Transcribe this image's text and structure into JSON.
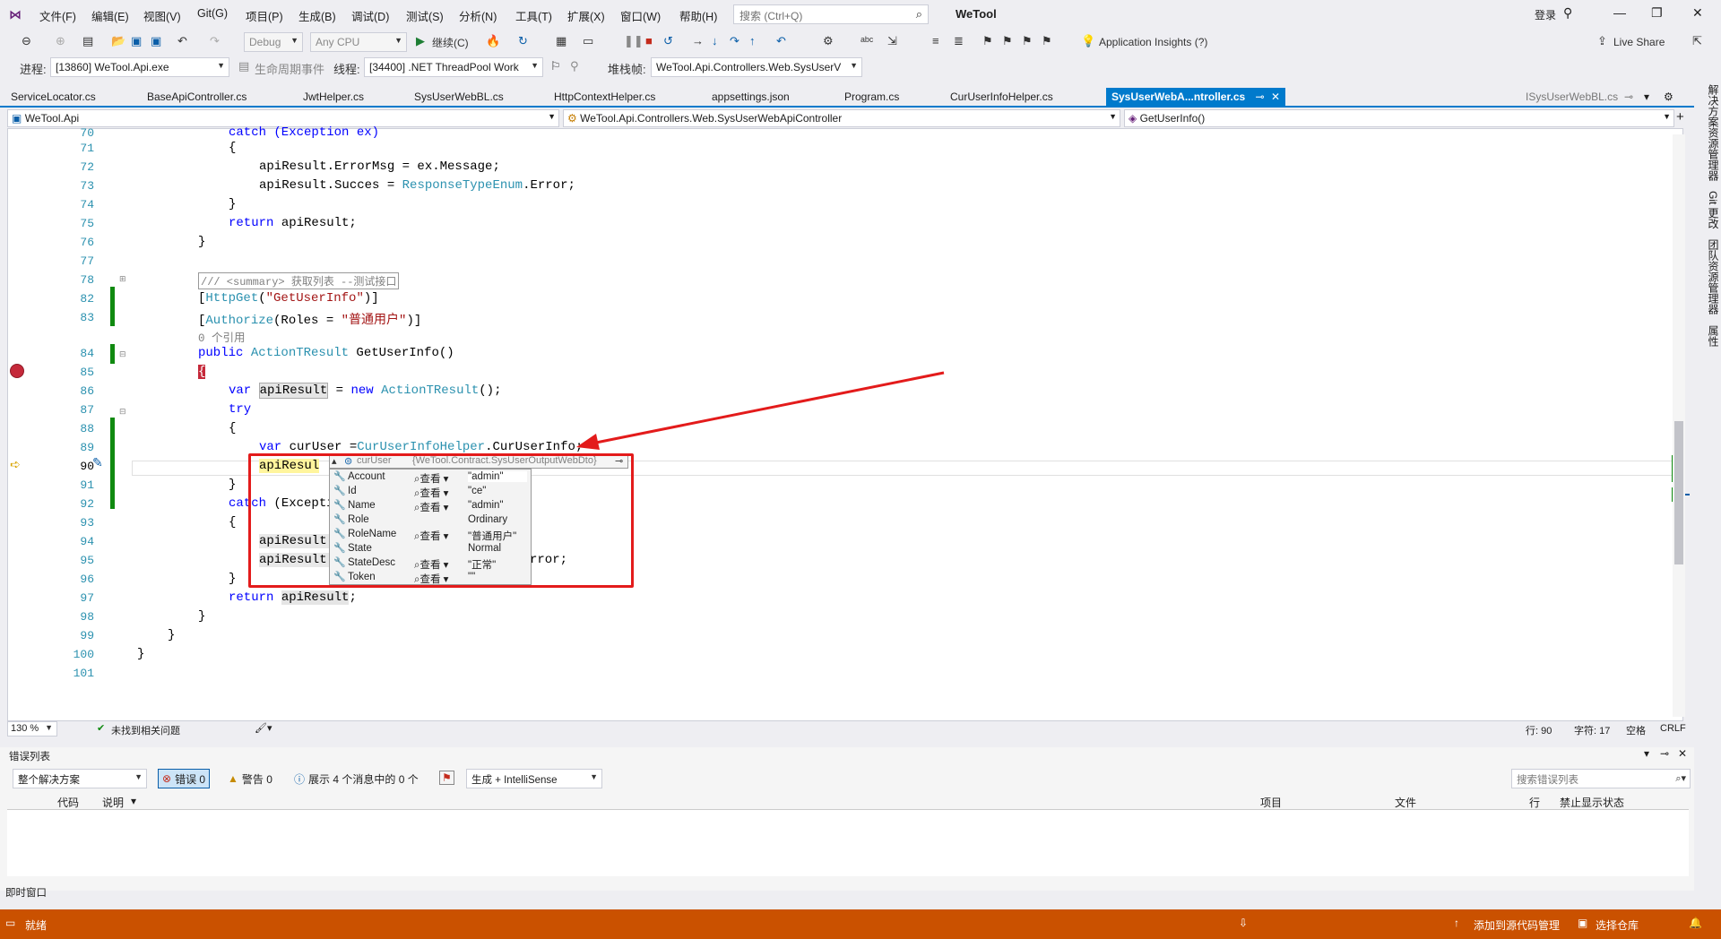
{
  "menu": {
    "items": [
      "文件(F)",
      "编辑(E)",
      "视图(V)",
      "Git(G)",
      "项目(P)",
      "生成(B)",
      "调试(D)",
      "测试(S)",
      "分析(N)",
      "工具(T)",
      "扩展(X)",
      "窗口(W)",
      "帮助(H)"
    ],
    "search_placeholder": "搜索 (Ctrl+Q)",
    "app_title": "WeTool",
    "login": "登录"
  },
  "toolbar": {
    "config": "Debug",
    "platform": "Any CPU",
    "continue_label": "继续(C)",
    "app_insights": "Application Insights (?)",
    "live_share": "Live Share",
    "process_label": "进程:",
    "process_value": "[13860] WeTool.Api.exe",
    "lifecycle_label": "生命周期事件",
    "thread_label": "线程:",
    "thread_value": "[34400] .NET ThreadPool Work",
    "stack_label": "堆栈帧:",
    "stack_value": "WeTool.Api.Controllers.Web.SysUserV"
  },
  "tabs": [
    {
      "label": "ServiceLocator.cs"
    },
    {
      "label": "BaseApiController.cs"
    },
    {
      "label": "JwtHelper.cs"
    },
    {
      "label": "SysUserWebBL.cs"
    },
    {
      "label": "HttpContextHelper.cs"
    },
    {
      "label": "appsettings.json"
    },
    {
      "label": "Program.cs"
    },
    {
      "label": "CurUserInfoHelper.cs"
    },
    {
      "label": "SysUserWebA...ntroller.cs"
    },
    {
      "label": "ISysUserWebBL.cs"
    }
  ],
  "nav": {
    "project": "WeTool.Api",
    "class": "WeTool.Api.Controllers.Web.SysUserWebApiController",
    "member": "GetUserInfo()"
  },
  "code": {
    "line_numbers": [
      "70",
      "71",
      "72",
      "73",
      "74",
      "75",
      "76",
      "77",
      "78",
      "82",
      "83",
      "84",
      "85",
      "86",
      "87",
      "88",
      "89",
      "90",
      "91",
      "92",
      "93",
      "94",
      "95",
      "96",
      "97",
      "98",
      "99",
      "100",
      "101"
    ],
    "l70": "catch (Exception ex)",
    "l71": "{",
    "l72_a": "apiResult.ErrorMsg = ex.Message;",
    "l73_a": "apiResult.Succes = ",
    "l73_b": "ResponseTypeEnum",
    "l73_c": ".Error;",
    "l74": "}",
    "l75_kw": "return",
    "l75_b": " apiResult;",
    "l76": "}",
    "l78": "/// <summary> 获取列表 --测试接口",
    "l82_a": "[",
    "l82_b": "HttpGet",
    "l82_c": "(",
    "l82_d": "\"GetUserInfo\"",
    "l82_e": ")]",
    "l83_a": "[",
    "l83_b": "Authorize",
    "l83_c": "(Roles = ",
    "l83_d": "\"普通用户\"",
    "l83_e": ")]",
    "refs": "0 个引用",
    "l84_kw": "public ",
    "l84_ty": "ActionTResult",
    "l84_c": " GetUserInfo()",
    "l85": "{",
    "l86_kw": "var ",
    "l86_b": "apiResult",
    "l86_c": " = ",
    "l86_d": "new ",
    "l86_e": "ActionTResult",
    "l86_f": "();",
    "l87": "try",
    "l88": "{",
    "l89_kw": "var ",
    "l89_b": "curUser =",
    "l89_c": "CurUserInfoHelper",
    "l89_d": ".CurUserInfo;",
    "l90": "apiResul",
    "l91": "}",
    "l92_kw": "catch",
    "l92_b": " (Excepti",
    "l93": "{",
    "l94": "apiResult.",
    "l95": "apiResult.",
    "l95_tail": "rror;",
    "l96": "}",
    "l97_kw": "ret",
    "l97_b": "urn ",
    "l97_c": "apiResult",
    "l97_d": ";",
    "l98": "}",
    "l99": "}",
    "l100": "}"
  },
  "datatip": {
    "header_name": "curUser",
    "header_type": "{WeTool.Contract.SysUserOutputWebDto}",
    "view_label": "查看",
    "rows": [
      {
        "name": "Account",
        "view": true,
        "value": "\"admin\""
      },
      {
        "name": "Id",
        "view": true,
        "value": "\"ce\""
      },
      {
        "name": "Name",
        "view": true,
        "value": "\"admin\""
      },
      {
        "name": "Role",
        "view": false,
        "value": "Ordinary"
      },
      {
        "name": "RoleName",
        "view": true,
        "value": "\"普通用户\""
      },
      {
        "name": "State",
        "view": false,
        "value": "Normal"
      },
      {
        "name": "StateDesc",
        "view": true,
        "value": "\"正常\""
      },
      {
        "name": "Token",
        "view": true,
        "value": "\"\""
      }
    ]
  },
  "editor_status": {
    "zoom": "130 %",
    "issues": "未找到相关问题",
    "line": "行: 90",
    "char": "字符: 17",
    "spaces": "空格",
    "eol": "CRLF"
  },
  "error_list": {
    "title": "错误列表",
    "scope": "整个解决方案",
    "errors": "错误 0",
    "warnings": "警告 0",
    "messages": "展示 4 个消息中的 0 个",
    "build_filter": "生成 + IntelliSense",
    "search_placeholder": "搜索错误列表",
    "columns": [
      "代码",
      "说明",
      "项目",
      "文件",
      "行",
      "禁止显示状态"
    ],
    "immediate": "即时窗口"
  },
  "status": {
    "ready": "就绪",
    "add_source": "添加到源代码管理",
    "select_repo": "选择仓库"
  },
  "right_panel": [
    "解决方案资源管理器",
    "Git 更改",
    "团队资源管理器",
    "属性"
  ],
  "colors": {
    "accent": "#007acc",
    "status_debug": "#ca5100",
    "annotation": "#e31b1b"
  }
}
